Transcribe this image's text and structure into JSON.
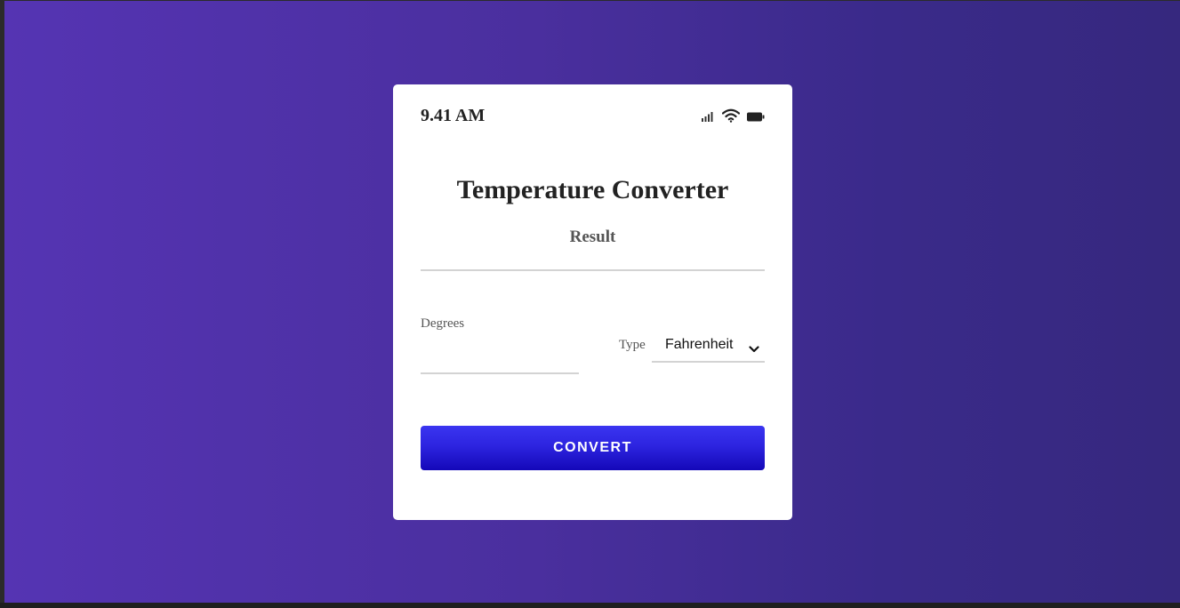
{
  "status_bar": {
    "time": "9.41 AM",
    "icons": [
      "signal-icon",
      "wifi-icon",
      "battery-icon"
    ]
  },
  "app": {
    "title": "Temperature Converter",
    "result_label": "Result",
    "result_value": ""
  },
  "form": {
    "degrees_label": "Degrees",
    "degrees_value": "",
    "type_label": "Type",
    "type_selected": "Fahrenheit",
    "convert_label": "CONVERT"
  },
  "colors": {
    "background_gradient_start": "#5534b3",
    "background_gradient_end": "#36287e",
    "button": "#2d24e0",
    "card": "#ffffff"
  }
}
